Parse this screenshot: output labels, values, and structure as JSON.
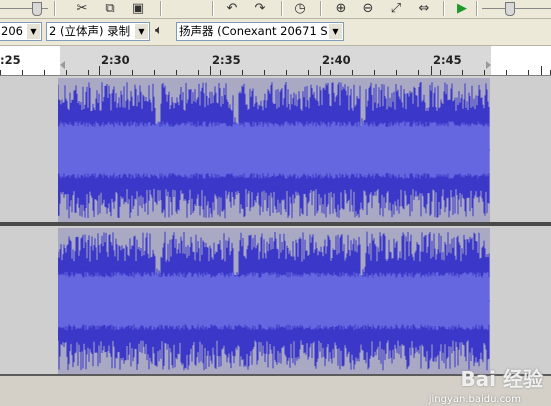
{
  "toolbar": {
    "icons": [
      "slider-thumb-icon",
      "cut-icon",
      "copy-icon",
      "paste-icon",
      "undo-icon",
      "redo-icon",
      "timer-icon",
      "zoom-in-icon",
      "zoom-out-icon",
      "fit-selection-icon",
      "fit-project-icon",
      "play-icon",
      "volume-slider-icon"
    ]
  },
  "device_bar": {
    "input_device_value": "206",
    "channels_value": "2 (立体声) 录制",
    "output_device_value": "扬声器 (Conexant 20671 S"
  },
  "ruler": {
    "labels": [
      ":25",
      "2:30",
      "2:35",
      "2:40",
      "2:45"
    ]
  },
  "watermark": {
    "main": "Bai 经验",
    "sub": "jingyan.baidu.com"
  },
  "colors": {
    "waveform": "#3a37c9",
    "waveform_rms": "#6467e0",
    "selection": "#a9a9c4",
    "track_bg": "#cfcfcf",
    "ruler_selection": "#d9d9d9"
  }
}
